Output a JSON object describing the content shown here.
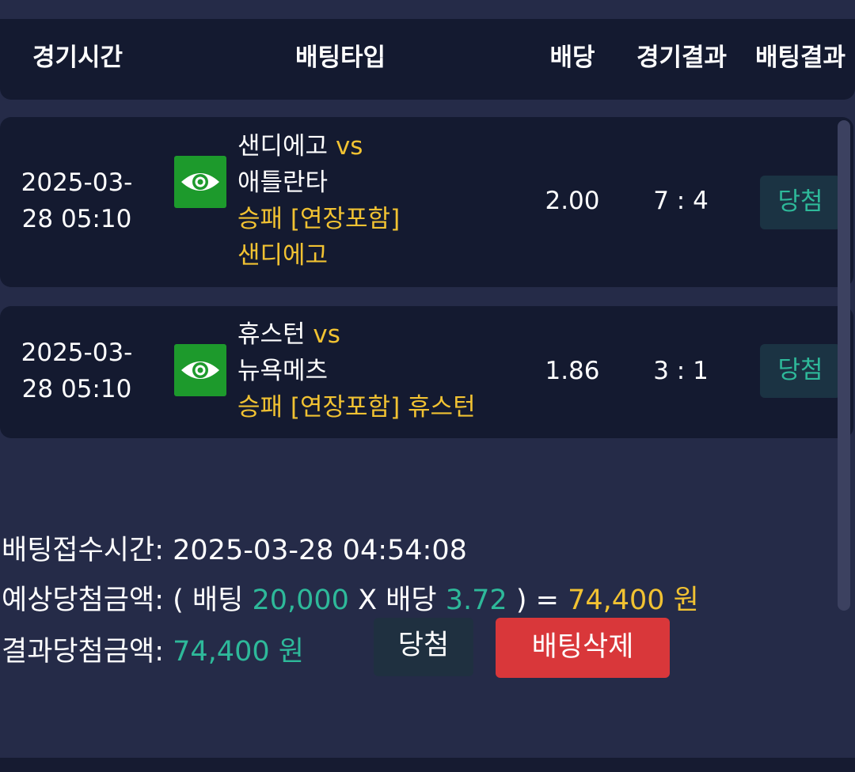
{
  "header": {
    "col_time": "경기시간",
    "col_type": "배팅타입",
    "col_odds": "배당",
    "col_result": "경기결과",
    "col_bet_result": "배팅결과"
  },
  "rows": [
    {
      "date_line1": "2025-03-",
      "date_line2": "28 05:10",
      "home": "샌디에고",
      "vs": "vs",
      "away": "애틀란타",
      "bet_type": "승패 [연장포함]",
      "pick": "샌디에고",
      "odds": "2.00",
      "score": "7 : 4",
      "result": "당첨"
    },
    {
      "date_line1": "2025-03-",
      "date_line2": "28 05:10",
      "home": "휴스턴",
      "vs": "vs",
      "away": "뉴욕메츠",
      "bet_type": "승패 [연장포함]",
      "pick": "휴스턴",
      "odds": "1.86",
      "score": "3 : 1",
      "result": "당첨"
    }
  ],
  "summary": {
    "received_label": "배팅접수시간:",
    "received_value": "2025-03-28 04:54:08",
    "expected_label": "예상당첨금액:",
    "expected_open": "( 배팅",
    "bet_amount": "20,000",
    "times": "X 배당",
    "total_odds": "3.72",
    "expected_close": ") =",
    "expected_amount": "74,400 원",
    "result_label": "결과당첨금액:",
    "result_amount": "74,400 원",
    "status_button": "당첨",
    "delete_button": "배팅삭제"
  },
  "colors": {
    "background": "#252b48",
    "panel": "#141a30",
    "accent_yellow": "#f1c232",
    "accent_green": "#2eb99a",
    "eye_button": "#1d9a2c",
    "delete_red": "#d9373a"
  },
  "icons": {
    "view": "eye-icon"
  }
}
